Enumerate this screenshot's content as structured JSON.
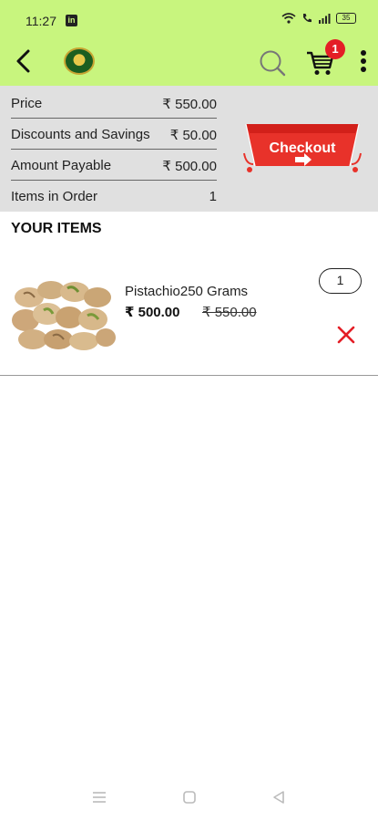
{
  "status_bar": {
    "time": "11:27",
    "app_badge": "in",
    "battery": "35"
  },
  "app_bar": {
    "cart_count": "1"
  },
  "summary": {
    "rows": [
      {
        "label": "Price",
        "value": "₹ 550.00"
      },
      {
        "label": "Discounts and Savings",
        "value": "₹ 50.00"
      },
      {
        "label": "Amount Payable",
        "value": "₹ 500.00"
      },
      {
        "label": "Items in Order",
        "value": "1"
      }
    ],
    "checkout_label": "Checkout"
  },
  "section_title": "YOUR ITEMS",
  "items": [
    {
      "name": "Pistachio250 Grams",
      "price": "₹ 500.00",
      "mrp": "₹ 550.00",
      "quantity": "1"
    }
  ],
  "colors": {
    "top_bar": "#c8f57e",
    "summary_bg": "#e0e0e0",
    "accent_red": "#e41e26"
  }
}
